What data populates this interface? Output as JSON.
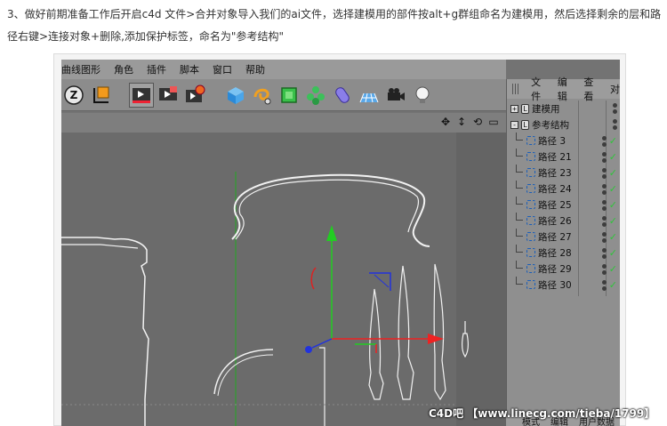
{
  "instruction": "3、做好前期准备工作后开启c4d 文件>合并对象导入我们的ai文件，选择建模用的部件按alt+g群组命名为建模用，然后选择剩余的层和路径右键>连接对象+删除,添加保护标签，命名为\"参考结构\"",
  "menubar": [
    "曲线图形",
    "角色",
    "插件",
    "脚本",
    "窗口",
    "帮助"
  ],
  "toolbar": {
    "groups": [
      {
        "icons": [
          "z-coordinate-icon",
          "world-axis-icon"
        ]
      },
      {
        "icons": [
          "render-view-icon",
          "render-picture-queue-icon",
          "render-settings-icon"
        ]
      },
      {
        "icons": [
          "cube-icon",
          "spline-pen-icon",
          "subdivision-icon",
          "cloner-icon",
          "deformer-icon",
          "floor-scene-icon",
          "camera-icon",
          "light-icon"
        ]
      }
    ]
  },
  "viewport": {
    "nav_icons": [
      "move-view-icon",
      "zoom-view-icon",
      "rotate-view-icon",
      "maximize-view-icon"
    ]
  },
  "object_manager": {
    "menu": [
      "文件",
      "编辑",
      "查看",
      "对"
    ],
    "objects": [
      {
        "name": "建模用",
        "expander": "+",
        "level": 0
      },
      {
        "name": "参考结构",
        "expander": "-",
        "level": 0
      },
      {
        "name": "路径 3",
        "level": 1
      },
      {
        "name": "路径 21",
        "level": 1
      },
      {
        "name": "路径 23",
        "level": 1
      },
      {
        "name": "路径 24",
        "level": 1
      },
      {
        "name": "路径 25",
        "level": 1
      },
      {
        "name": "路径 26",
        "level": 1
      },
      {
        "name": "路径 27",
        "level": 1
      },
      {
        "name": "路径 28",
        "level": 1
      },
      {
        "name": "路径 29",
        "level": 1
      },
      {
        "name": "路径 30",
        "level": 1
      }
    ],
    "bottom_tabs": [
      "模式",
      "编辑",
      "用户数据"
    ]
  },
  "watermark": "C4D吧 【www.linecg.com/tieba/1799】",
  "colors": {
    "viewport_bg": "#6b6b6b",
    "y_axis": "#22cc22",
    "x_axis": "#ee2222",
    "z_axis": "#2233dd",
    "spline": "#f0f0f0",
    "check": "#2fc43a"
  }
}
